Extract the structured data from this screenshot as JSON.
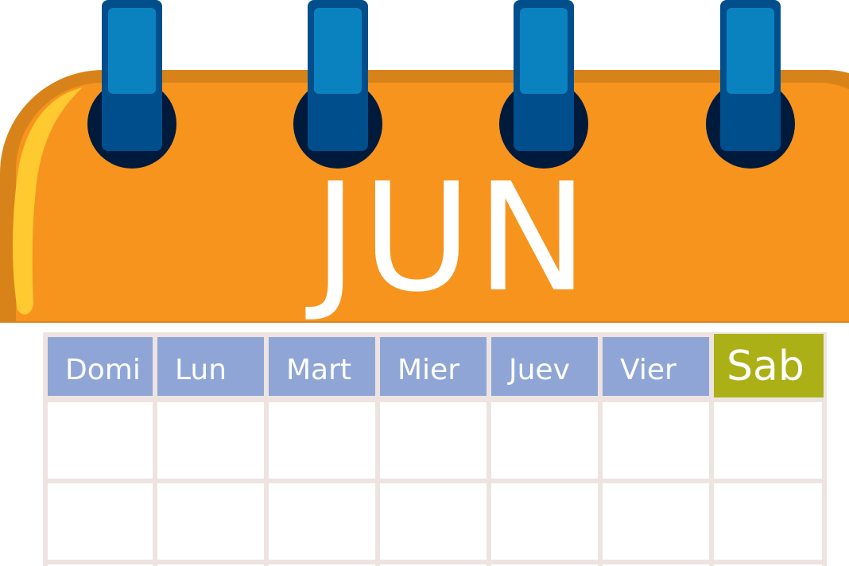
{
  "calendar": {
    "month": "JUN",
    "days": [
      {
        "label": "Domi"
      },
      {
        "label": "Lun"
      },
      {
        "label": "Mart"
      },
      {
        "label": "Mier"
      },
      {
        "label": "Juev"
      },
      {
        "label": "Vier"
      },
      {
        "label": "Sab",
        "highlighted": true
      }
    ],
    "visible_week_rows": 3
  },
  "colors": {
    "header_orange": "#f7941e",
    "header_orange_dark": "#d8831a",
    "highlight_yellow": "#ffc930",
    "ring_blue": "#0a82c0",
    "ring_blue_dark": "#004e8c",
    "hole_navy": "#001a3c",
    "day_header_blue": "#8ea5d6",
    "saturday_green": "#acb017",
    "grid_line": "#ede4e2",
    "page_shadow": "#dcdde0"
  },
  "icons": {
    "binder_ring": "binder-ring-icon"
  }
}
